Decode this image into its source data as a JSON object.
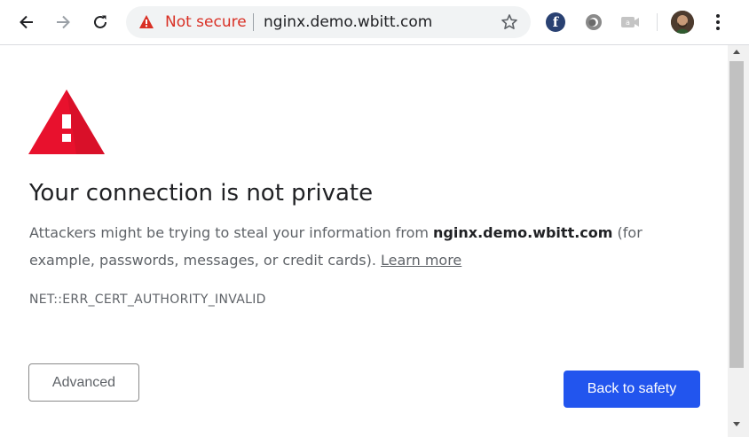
{
  "browser": {
    "security_label": "Not secure",
    "url": "nginx.demo.wbitt.com",
    "colors": {
      "insecure": "#d93025",
      "omnibox_bg": "#f1f3f4"
    },
    "toolbar_icons": [
      "back-arrow-icon",
      "forward-arrow-icon",
      "reload-icon",
      "warning-icon",
      "star-icon",
      "fedora-extension-icon",
      "circle-extension-icon",
      "camera-extension-icon",
      "profile-avatar",
      "more-vert-icon"
    ]
  },
  "page": {
    "heading": "Your connection is not private",
    "desc_pre": "Attackers might be trying to steal your information from ",
    "desc_host": "nginx.demo.wbitt.com",
    "desc_post": " (for example, passwords, messages, or credit cards). ",
    "learn_more": "Learn more",
    "error_code": "NET::ERR_CERT_AUTHORITY_INVALID",
    "advanced_label": "Advanced",
    "back_label": "Back to safety",
    "colors": {
      "warning_red": "#e8112d",
      "primary_button": "#2255ee"
    }
  }
}
